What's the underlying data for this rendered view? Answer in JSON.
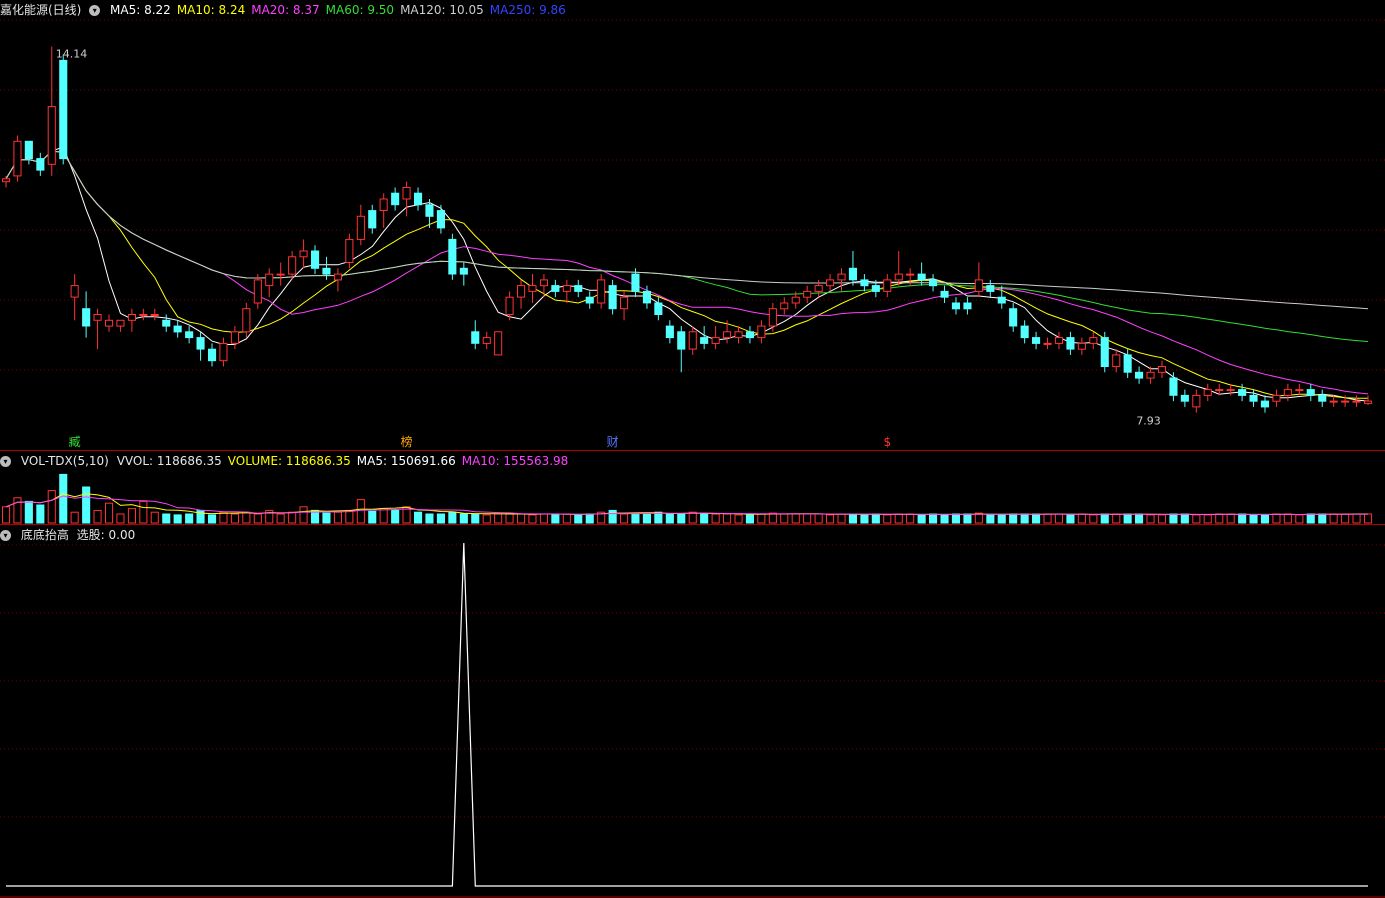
{
  "stock": {
    "name_label": "嘉化能源(日线)"
  },
  "price_legend": [
    {
      "label": "MA5: 8.22",
      "color": "#ffffff"
    },
    {
      "label": "MA10: 8.24",
      "color": "#ffff00"
    },
    {
      "label": "MA20: 8.37",
      "color": "#ff40ff"
    },
    {
      "label": "MA60: 9.50",
      "color": "#33dd33"
    },
    {
      "label": "MA120: 10.05",
      "color": "#cccccc"
    },
    {
      "label": "MA250: 9.86",
      "color": "#3344ff"
    }
  ],
  "vol_legend": {
    "title": "VOL-TDX(5,10)",
    "items": [
      {
        "label": "VVOL: 118686.35",
        "color": "#e6e6e6"
      },
      {
        "label": "VOLUME: 118686.35",
        "color": "#ffff00"
      },
      {
        "label": "MA5: 150691.66",
        "color": "#ffffff"
      },
      {
        "label": "MA10: 155563.98",
        "color": "#ff40ff"
      }
    ]
  },
  "ind_legend": {
    "title": "底底抬高",
    "items": [
      {
        "label": "选股: 0.00",
        "color": "#e6e6e6"
      }
    ]
  },
  "annotations": {
    "high": "14.14",
    "low": "7.93"
  },
  "markers": [
    {
      "label": "臧",
      "color": "#33dd33",
      "index": 6
    },
    {
      "label": "榜",
      "color": "#ffaa00",
      "index": 35
    },
    {
      "label": "财",
      "color": "#5577ff",
      "index": 53
    },
    {
      "label": "$",
      "color": "#ff3333",
      "index": 77
    }
  ],
  "colors": {
    "up": "#ff3333",
    "down": "#54ffff",
    "grid": "#7a0000",
    "separator": "#b00000"
  },
  "chart_data": {
    "type": "candlestick",
    "ylim": [
      7.5,
      14.6
    ],
    "signal_index": 40,
    "candles": [
      [
        11.8,
        11.9,
        11.7,
        11.85
      ],
      [
        11.9,
        12.6,
        11.8,
        12.5
      ],
      [
        12.5,
        12.5,
        12.1,
        12.2
      ],
      [
        12.2,
        12.3,
        11.9,
        12.0
      ],
      [
        12.1,
        14.14,
        11.9,
        13.1
      ],
      [
        13.9,
        14.0,
        12.1,
        12.2
      ],
      [
        9.8,
        10.2,
        9.4,
        10.0
      ],
      [
        9.6,
        9.9,
        9.1,
        9.3
      ],
      [
        9.4,
        9.6,
        8.9,
        9.5
      ],
      [
        9.3,
        9.5,
        9.2,
        9.4
      ],
      [
        9.3,
        9.4,
        9.2,
        9.4
      ],
      [
        9.4,
        9.6,
        9.2,
        9.5
      ],
      [
        9.5,
        9.6,
        9.4,
        9.5
      ],
      [
        9.5,
        9.6,
        9.4,
        9.5
      ],
      [
        9.4,
        9.5,
        9.2,
        9.3
      ],
      [
        9.3,
        9.4,
        9.1,
        9.2
      ],
      [
        9.2,
        9.3,
        9.0,
        9.1
      ],
      [
        9.1,
        9.2,
        8.7,
        8.9
      ],
      [
        8.9,
        9.0,
        8.6,
        8.7
      ],
      [
        8.7,
        9.1,
        8.6,
        9.0
      ],
      [
        9.0,
        9.3,
        8.9,
        9.2
      ],
      [
        9.2,
        9.7,
        9.1,
        9.6
      ],
      [
        9.7,
        10.2,
        9.6,
        10.1
      ],
      [
        10.0,
        10.3,
        9.8,
        10.2
      ],
      [
        10.2,
        10.4,
        10.0,
        10.2
      ],
      [
        10.2,
        10.6,
        10.1,
        10.5
      ],
      [
        10.5,
        10.8,
        10.3,
        10.6
      ],
      [
        10.6,
        10.7,
        10.2,
        10.3
      ],
      [
        10.3,
        10.5,
        10.1,
        10.2
      ],
      [
        10.1,
        10.3,
        9.9,
        10.2
      ],
      [
        10.4,
        10.9,
        10.3,
        10.8
      ],
      [
        10.8,
        11.4,
        10.7,
        11.2
      ],
      [
        11.3,
        11.4,
        10.9,
        11.0
      ],
      [
        11.3,
        11.6,
        11.0,
        11.5
      ],
      [
        11.6,
        11.7,
        11.3,
        11.4
      ],
      [
        11.5,
        11.8,
        11.2,
        11.7
      ],
      [
        11.6,
        11.7,
        11.3,
        11.4
      ],
      [
        11.4,
        11.5,
        11.0,
        11.2
      ],
      [
        11.3,
        11.4,
        10.9,
        11.0
      ],
      [
        10.8,
        10.9,
        10.1,
        10.2
      ],
      [
        10.3,
        10.4,
        10.0,
        10.2
      ],
      [
        9.2,
        9.4,
        8.9,
        9.0
      ],
      [
        9.0,
        9.2,
        8.9,
        9.1
      ],
      [
        8.8,
        9.2,
        8.8,
        9.2
      ],
      [
        9.5,
        9.9,
        9.4,
        9.8
      ],
      [
        9.8,
        10.1,
        9.6,
        10.0
      ],
      [
        9.9,
        10.2,
        9.7,
        10.0
      ],
      [
        10.0,
        10.2,
        9.8,
        10.1
      ],
      [
        10.0,
        10.1,
        9.8,
        9.9
      ],
      [
        9.9,
        10.1,
        9.7,
        10.0
      ],
      [
        10.0,
        10.1,
        9.8,
        9.9
      ],
      [
        9.8,
        9.9,
        9.6,
        9.7
      ],
      [
        9.7,
        10.2,
        9.6,
        10.1
      ],
      [
        10.0,
        10.1,
        9.5,
        9.6
      ],
      [
        9.6,
        9.9,
        9.4,
        9.8
      ],
      [
        10.2,
        10.3,
        9.8,
        9.9
      ],
      [
        9.9,
        10.0,
        9.6,
        9.7
      ],
      [
        9.7,
        9.8,
        9.4,
        9.5
      ],
      [
        9.3,
        9.4,
        9.0,
        9.1
      ],
      [
        9.2,
        9.3,
        8.5,
        8.9
      ],
      [
        8.9,
        9.3,
        8.8,
        9.2
      ],
      [
        9.1,
        9.3,
        8.9,
        9.0
      ],
      [
        9.0,
        9.3,
        8.9,
        9.1
      ],
      [
        9.1,
        9.4,
        9.0,
        9.2
      ],
      [
        9.1,
        9.3,
        9.0,
        9.2
      ],
      [
        9.2,
        9.3,
        9.0,
        9.1
      ],
      [
        9.1,
        9.4,
        9.0,
        9.3
      ],
      [
        9.3,
        9.7,
        9.2,
        9.6
      ],
      [
        9.6,
        9.8,
        9.5,
        9.7
      ],
      [
        9.7,
        9.9,
        9.6,
        9.8
      ],
      [
        9.8,
        10.0,
        9.7,
        9.9
      ],
      [
        9.9,
        10.1,
        9.8,
        10.0
      ],
      [
        10.0,
        10.2,
        9.9,
        10.1
      ],
      [
        10.1,
        10.3,
        9.9,
        10.2
      ],
      [
        10.3,
        10.6,
        10.0,
        10.1
      ],
      [
        10.1,
        10.2,
        9.9,
        10.0
      ],
      [
        10.0,
        10.1,
        9.8,
        9.9
      ],
      [
        9.9,
        10.2,
        9.8,
        10.1
      ],
      [
        10.1,
        10.6,
        10.0,
        10.2
      ],
      [
        10.2,
        10.3,
        10.0,
        10.2
      ],
      [
        10.2,
        10.4,
        10.0,
        10.1
      ],
      [
        10.1,
        10.2,
        9.9,
        10.0
      ],
      [
        9.9,
        10.0,
        9.7,
        9.8
      ],
      [
        9.7,
        9.8,
        9.5,
        9.6
      ],
      [
        9.7,
        9.8,
        9.5,
        9.6
      ],
      [
        9.9,
        10.4,
        9.8,
        10.1
      ],
      [
        10.0,
        10.1,
        9.8,
        9.9
      ],
      [
        9.8,
        10.0,
        9.6,
        9.7
      ],
      [
        9.6,
        9.7,
        9.2,
        9.3
      ],
      [
        9.3,
        9.4,
        9.0,
        9.1
      ],
      [
        9.1,
        9.2,
        8.9,
        9.0
      ],
      [
        9.0,
        9.1,
        8.9,
        9.0
      ],
      [
        9.0,
        9.2,
        8.9,
        9.1
      ],
      [
        9.1,
        9.2,
        8.8,
        8.9
      ],
      [
        8.9,
        9.1,
        8.8,
        9.0
      ],
      [
        9.0,
        9.2,
        8.9,
        9.1
      ],
      [
        9.1,
        9.2,
        8.5,
        8.6
      ],
      [
        8.6,
        8.9,
        8.5,
        8.8
      ],
      [
        8.8,
        8.9,
        8.4,
        8.5
      ],
      [
        8.5,
        8.6,
        8.3,
        8.4
      ],
      [
        8.4,
        8.6,
        8.3,
        8.5
      ],
      [
        8.5,
        8.7,
        8.4,
        8.6
      ],
      [
        8.4,
        8.5,
        8.0,
        8.1
      ],
      [
        8.1,
        8.2,
        7.9,
        8.0
      ],
      [
        7.9,
        8.2,
        7.8,
        8.1
      ],
      [
        8.1,
        8.3,
        8.0,
        8.2
      ],
      [
        8.2,
        8.3,
        8.1,
        8.2
      ],
      [
        8.2,
        8.3,
        8.1,
        8.2
      ],
      [
        8.2,
        8.3,
        8.0,
        8.1
      ],
      [
        8.1,
        8.2,
        7.9,
        8.0
      ],
      [
        8.0,
        8.1,
        7.8,
        7.9
      ],
      [
        8.0,
        8.2,
        7.9,
        8.1
      ],
      [
        8.1,
        8.3,
        8.0,
        8.2
      ],
      [
        8.2,
        8.3,
        8.1,
        8.2
      ],
      [
        8.2,
        8.3,
        8.0,
        8.1
      ],
      [
        8.1,
        8.2,
        7.9,
        8.0
      ],
      [
        8.0,
        8.1,
        7.9,
        8.0
      ],
      [
        8.0,
        8.1,
        7.9,
        8.0
      ],
      [
        8.0,
        8.1,
        7.9,
        8.0
      ],
      [
        7.96,
        8.1,
        7.93,
        8.0
      ]
    ],
    "volume": [
      18,
      28,
      24,
      20,
      36,
      54,
      12,
      40,
      14,
      22,
      10,
      16,
      24,
      12,
      10,
      9,
      10,
      14,
      9,
      12,
      10,
      12,
      10,
      14,
      10,
      12,
      18,
      14,
      11,
      12,
      14,
      26,
      13,
      16,
      14,
      18,
      12,
      10,
      10,
      12,
      10,
      10,
      9,
      10,
      11,
      10,
      9,
      10,
      10,
      10,
      9,
      10,
      12,
      14,
      10,
      10,
      11,
      12,
      10,
      10,
      12,
      10,
      10,
      10,
      9,
      10,
      10,
      11,
      10,
      10,
      10,
      10,
      9,
      10,
      10,
      9,
      10,
      9,
      10,
      10,
      9,
      10,
      9,
      10,
      10,
      11,
      9,
      9,
      10,
      10,
      10,
      10,
      10,
      9,
      10,
      9,
      10,
      10,
      10,
      10,
      9,
      9,
      10,
      10,
      9,
      9,
      10,
      10,
      10,
      9,
      9,
      10,
      10,
      9,
      10,
      10,
      10,
      10,
      10,
      10
    ],
    "vol_max": 60
  }
}
